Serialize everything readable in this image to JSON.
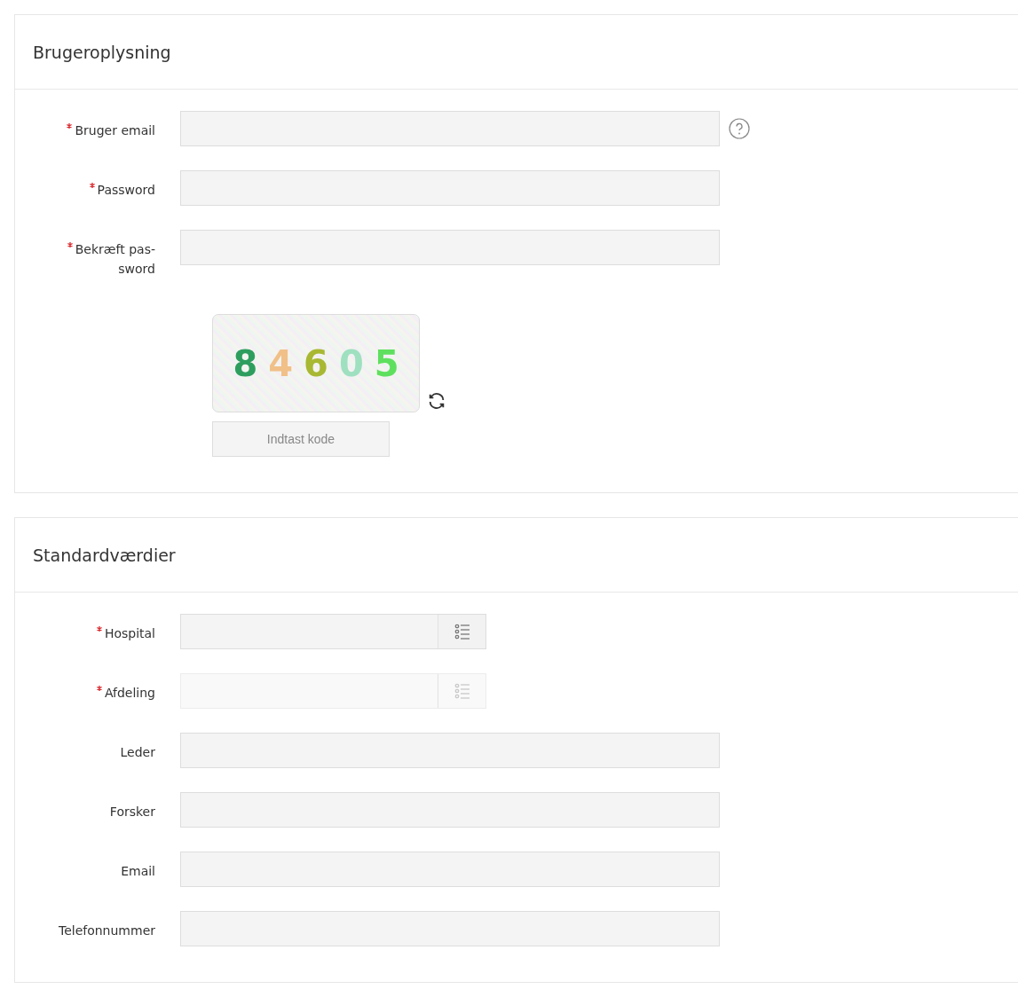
{
  "sections": [
    {
      "title": "Brugeroplysning",
      "fields": [
        {
          "kind": "text",
          "label": "Bruger email",
          "required": true,
          "help": true
        },
        {
          "kind": "text",
          "label": "Password",
          "required": true
        },
        {
          "kind": "text",
          "label": "Bekræft pas-sword",
          "required": true
        },
        {
          "kind": "captcha",
          "characters": [
            {
              "char": "8",
              "color": "#2e9e5e"
            },
            {
              "char": "4",
              "color": "#f0c088"
            },
            {
              "char": "6",
              "color": "#a8b832"
            },
            {
              "char": "0",
              "color": "#9ee0c0"
            },
            {
              "char": "5",
              "color": "#5ee05e"
            }
          ],
          "placeholder": "Indtast kode"
        }
      ]
    },
    {
      "title": "Standardværdier",
      "fields": [
        {
          "kind": "lookup",
          "label": "Hospital",
          "required": true,
          "disabled": false
        },
        {
          "kind": "lookup",
          "label": "Afdeling",
          "required": true,
          "disabled": true
        },
        {
          "kind": "text",
          "label": "Leder",
          "required": false
        },
        {
          "kind": "text",
          "label": "Forsker",
          "required": false
        },
        {
          "kind": "text",
          "label": "Email",
          "required": false
        },
        {
          "kind": "text",
          "label": "Telefonnummer",
          "required": false
        }
      ]
    }
  ]
}
